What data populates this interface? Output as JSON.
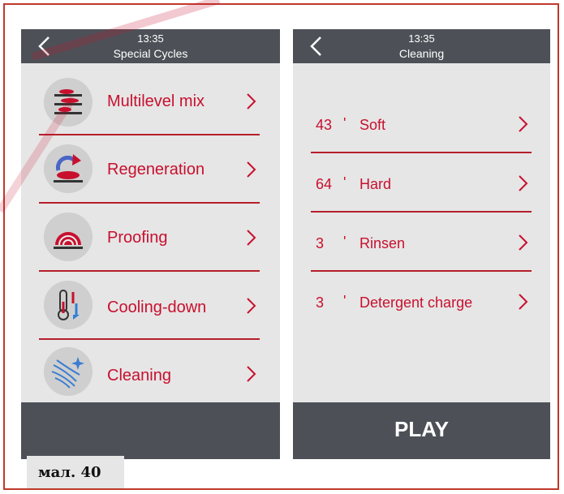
{
  "left_screen": {
    "time": "13:35",
    "title": "Special Cycles",
    "items": [
      {
        "label": "Multilevel mix",
        "icon": "multilevel-icon"
      },
      {
        "label": "Regeneration",
        "icon": "regeneration-icon"
      },
      {
        "label": "Proofing",
        "icon": "proofing-icon"
      },
      {
        "label": "Cooling-down",
        "icon": "cooling-icon"
      },
      {
        "label": "Cleaning",
        "icon": "cleaning-icon"
      }
    ]
  },
  "right_screen": {
    "time": "13:35",
    "title": "Cleaning",
    "items": [
      {
        "minutes": "43",
        "unit": "'",
        "label": "Soft"
      },
      {
        "minutes": "64",
        "unit": "'",
        "label": "Hard"
      },
      {
        "minutes": "3",
        "unit": "'",
        "label": "Rinsen"
      },
      {
        "minutes": "3",
        "unit": "'",
        "label": "Detergent charge"
      }
    ],
    "play_label": "PLAY"
  },
  "caption": "мал. 40",
  "colors": {
    "accent": "#c8102e",
    "header": "#4d5157",
    "panel": "#e6e6e6"
  }
}
